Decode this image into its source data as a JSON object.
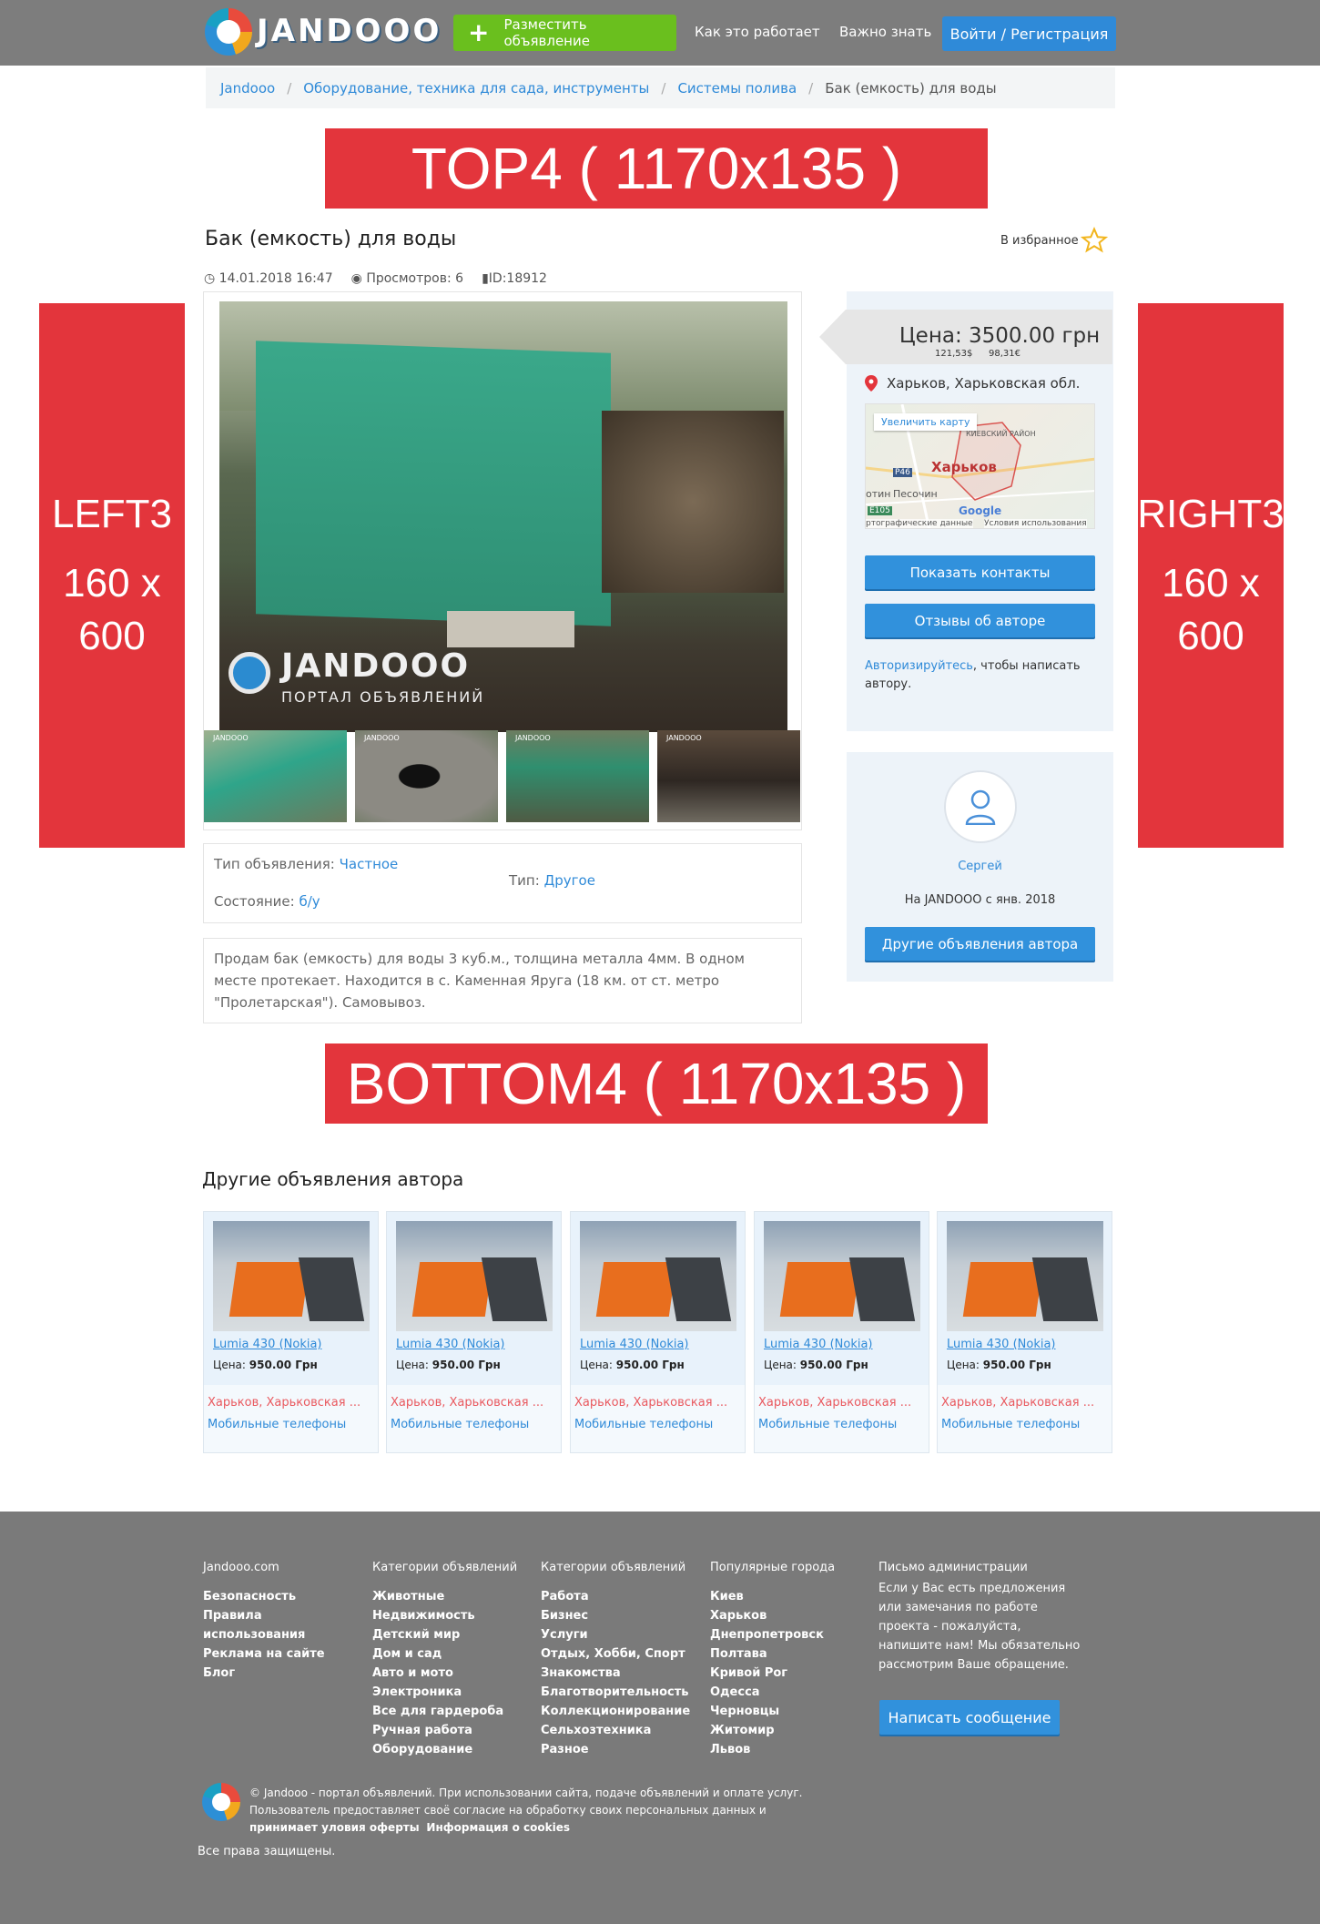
{
  "header": {
    "logo_text": "JANDOOO",
    "post_ad": "Разместить объявление",
    "nav": [
      "Как это работает",
      "Важно знать"
    ],
    "login": "Войти / Регистрация"
  },
  "breadcrumb": [
    "Jandooo",
    "Оборудование, техника для сада, инструменты",
    "Системы полива",
    "Бак (емкость) для воды"
  ],
  "ads": {
    "top": "TOP4  ( 1170x135 )",
    "left_name": "LEFT3",
    "left_size_a": "160 x",
    "left_size_b": "600",
    "right_name": "RIGHT3",
    "right_size_a": "160 x",
    "right_size_b": "600",
    "bottom": "BOTTOM4 ( 1170x135 )"
  },
  "listing": {
    "title": "Бак (емкость) для воды",
    "favorite": "В избранное",
    "date": "14.01.2018 16:47",
    "views": "Просмотров: 6",
    "id": "ID:18912",
    "watermark_name": "JANDOOO",
    "watermark_sub": "ПОРТАЛ ОБЪЯВЛЕНИЙ",
    "thumb_mark": "JANDOOO",
    "props": {
      "type_label": "Тип объявления:",
      "type_value": "Частное",
      "kind_label": "Тип:",
      "kind_value": "Другое",
      "state_label": "Состояние:",
      "state_value": "б/у"
    },
    "description": "Продам бак (емкость) для воды 3 куб.м., толщина металла 4мм. В одном месте протекает. Находится в с. Каменная Яруга (18 км. от ст. метро \"Пролетарская\"). Самовывоз."
  },
  "sidebar": {
    "price": "Цена: 3500.00 грн",
    "price_usd": "121,53$",
    "price_eur": "98,31€",
    "location": "Харьков, Харьковская обл.",
    "map": {
      "zoom": "Увеличить карту",
      "city": "Харьков",
      "district": "КИЕВСКИЙ РАЙОН",
      "village": "Песочин",
      "road1": "P46",
      "road2": "E105",
      "cut": "отин",
      "credits_left": "ртографические данные",
      "credits_right": "Условия использования",
      "google": "Google"
    },
    "show_contacts": "Показать контакты",
    "reviews": "Отзывы об авторе",
    "auth_link": "Авторизируйтесь",
    "auth_rest": ", чтобы написать автору."
  },
  "author": {
    "name": "Сергей",
    "since_prefix": "На ",
    "since_brand": "JANDOOO",
    "since_suffix": " с янв. 2018",
    "other_ads_btn": "Другие объявления автора"
  },
  "other_ads": {
    "heading": "Другие объявления автора",
    "items": [
      {
        "title": "Lumia 430 (Nokia)",
        "price_label": "Цена: ",
        "price": "950.00 Грн",
        "city": "Харьков, Харьковская ...",
        "category": "Мобильные телефоны"
      },
      {
        "title": "Lumia 430 (Nokia)",
        "price_label": "Цена: ",
        "price": "950.00 Грн",
        "city": "Харьков, Харьковская ...",
        "category": "Мобильные телефоны"
      },
      {
        "title": "Lumia 430 (Nokia)",
        "price_label": "Цена: ",
        "price": "950.00 Грн",
        "city": "Харьков, Харьковская ...",
        "category": "Мобильные телефоны"
      },
      {
        "title": "Lumia 430 (Nokia)",
        "price_label": "Цена: ",
        "price": "950.00 Грн",
        "city": "Харьков, Харьковская ...",
        "category": "Мобильные телефоны"
      },
      {
        "title": "Lumia 430 (Nokia)",
        "price_label": "Цена: ",
        "price": "950.00 Грн",
        "city": "Харьков, Харьковская ...",
        "category": "Мобильные телефоны"
      }
    ]
  },
  "footer": {
    "col1": {
      "title": "Jandooo.com",
      "items": [
        "Безопасность",
        "Правила",
        "использования",
        "Реклама на сайте",
        "Блог"
      ]
    },
    "col2": {
      "title": "Категории объявлений",
      "items": [
        "Животные",
        "Недвижимость",
        "Детский мир",
        "Дом и сад",
        "Авто и мото",
        "Электроника",
        "Все для гардероба",
        "Ручная работа",
        "Оборудование"
      ]
    },
    "col3": {
      "title": "Категории объявлений",
      "items": [
        "Работа",
        "Бизнес",
        "Услуги",
        "Отдых, Хобби, Спорт",
        "Знакомства",
        "Благотворительность",
        "Коллекционирование",
        "Сельхозтехника",
        "Разное"
      ]
    },
    "col4": {
      "title": "Популярные города",
      "items": [
        "Киев",
        "Харьков",
        "Днепропетровск",
        "Полтава",
        "Кривой Рог",
        "Одесса",
        "Черновцы",
        "Житомир",
        "Львов"
      ]
    },
    "letter_title": "Письмо администрации",
    "letter_text": "Если у Вас есть предложения или замечания по работе проекта - пожалуйста, напишите нам! Мы обязательно рассмотрим Ваше обращение.",
    "write_btn": "Написать сообщение",
    "copy_a": "© Jandooo - портал объявлений. При использовании сайта, подаче объявлений и оплате услуг. Пользователь предоставляет своё согласие на обработку своих персональных данных и ",
    "copy_link1": "принимает уловия оферты",
    "copy_link2": "Информация о cookies",
    "rights": "Все права защищены."
  },
  "colors": {
    "header_bg": "#7d7d7d",
    "accent_blue": "#2f8ad8",
    "green": "#6abf1e",
    "ad_red": "#e3353c"
  }
}
